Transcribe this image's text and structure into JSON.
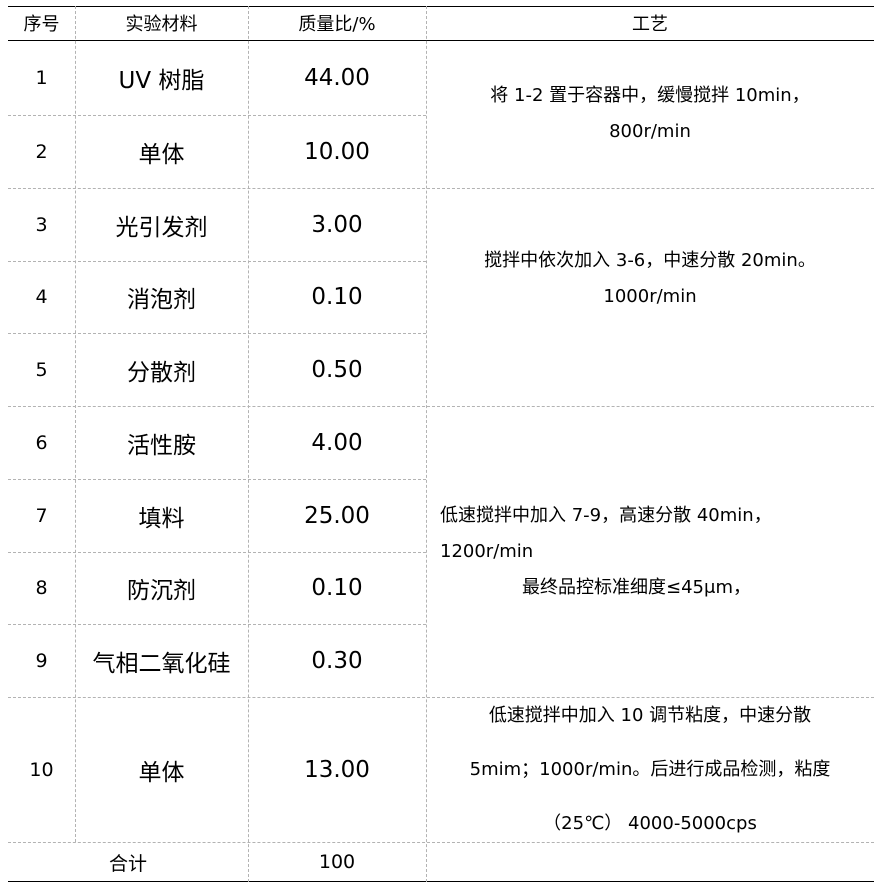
{
  "headers": {
    "seq": "序号",
    "material": "实验材料",
    "ratio": "质量比/%",
    "process": "工艺"
  },
  "rows": [
    {
      "seq": "1",
      "material": "UV 树脂",
      "ratio": "44.00"
    },
    {
      "seq": "2",
      "material": "单体",
      "ratio": "10.00"
    },
    {
      "seq": "3",
      "material": "光引发剂",
      "ratio": "3.00"
    },
    {
      "seq": "4",
      "material": "消泡剂",
      "ratio": "0.10"
    },
    {
      "seq": "5",
      "material": "分散剂",
      "ratio": "0.50"
    },
    {
      "seq": "6",
      "material": "活性胺",
      "ratio": "4.00"
    },
    {
      "seq": "7",
      "material": "填料",
      "ratio": "25.00"
    },
    {
      "seq": "8",
      "material": "防沉剂",
      "ratio": "0.10"
    },
    {
      "seq": "9",
      "material": "气相二氧化硅",
      "ratio": "0.30"
    },
    {
      "seq": "10",
      "material": "单体",
      "ratio": "13.00"
    }
  ],
  "process": [
    {
      "lines": [
        "将 1-2 置于容器中，缓慢搅拌 10min，",
        "800r/min"
      ]
    },
    {
      "lines": [
        "搅拌中依次加入 3-6，中速分散 20min。",
        "1000r/min"
      ]
    },
    {
      "lines": [
        "低速搅拌中加入 7-9，高速分散 40min，",
        "1200r/min",
        "最终品控标准细度≤45μm，"
      ]
    },
    {
      "lines": [
        "低速搅拌中加入 10 调节粘度，中速分散",
        "5mim；1000r/min。后进行成品检测，粘度",
        "（25℃）  4000-5000cps"
      ]
    }
  ],
  "total": {
    "label": "合计",
    "value": "100"
  }
}
